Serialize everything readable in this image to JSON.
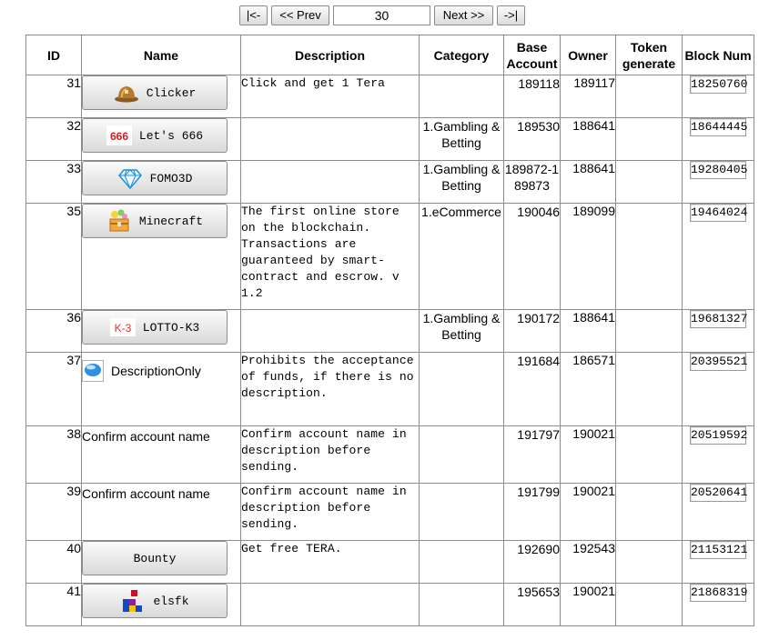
{
  "pager": {
    "first_label": "|<-",
    "prev_label": "<< Prev",
    "page_value": "30",
    "next_label": "Next >>",
    "last_label": "->|"
  },
  "table": {
    "headers": {
      "id": "ID",
      "name": "Name",
      "description": "Description",
      "category": "Category",
      "base_account_1": "Base",
      "base_account_2": "Account",
      "owner": "Owner",
      "token_1": "Token",
      "token_2": "generate",
      "block": "Block Num"
    },
    "rows": [
      {
        "id": "31",
        "name": "Clicker",
        "icon": "helmet-icon",
        "description": "Click and get 1 Tera",
        "category": "",
        "base": "189118",
        "owner": "189117",
        "token": "",
        "block": "18250760"
      },
      {
        "id": "32",
        "name": "Let's 666",
        "icon": "666-logo-icon",
        "description": "",
        "category": "1.Gambling & Betting",
        "base": "189530",
        "owner": "188641",
        "token": "",
        "block": "18644445"
      },
      {
        "id": "33",
        "name": "FOMO3D",
        "icon": "diamond-icon",
        "description": "",
        "category": "1.Gambling & Betting",
        "base": "189872-189873",
        "owner": "188641",
        "token": "",
        "block": "19280405"
      },
      {
        "id": "35",
        "name": "Minecraft",
        "icon": "treasure-chest-icon",
        "description": "The first online store on the blockchain. Transactions are guaranteed by smart-contract and escrow. v 1.2",
        "category": "1.eCommerce",
        "base": "190046",
        "owner": "189099",
        "token": "",
        "block": "19464024"
      },
      {
        "id": "36",
        "name": "LOTTO-K3",
        "icon": "k3-logo-icon",
        "description": "",
        "category": "1.Gambling & Betting",
        "base": "190172",
        "owner": "188641",
        "token": "",
        "block": "19681327"
      },
      {
        "id": "37",
        "name": "DescriptionOnly",
        "icon": "blue-sphere-icon",
        "description": "Prohibits the acceptance of funds, if there is no description.",
        "category": "",
        "base": "191684",
        "owner": "186571",
        "token": "",
        "block": "20395521"
      },
      {
        "id": "38",
        "name": "Confirm account name",
        "icon": "",
        "description": "Confirm account name in description before sending.",
        "category": "",
        "base": "191797",
        "owner": "190021",
        "token": "",
        "block": "20519592"
      },
      {
        "id": "39",
        "name": "Confirm account name",
        "icon": "",
        "description": "Confirm account name in description before sending.",
        "category": "",
        "base": "191799",
        "owner": "190021",
        "token": "",
        "block": "20520641"
      },
      {
        "id": "40",
        "name": "Bounty",
        "icon": "",
        "description": "Get free TERA.",
        "category": "",
        "base": "192690",
        "owner": "192543",
        "token": "",
        "block": "21153121"
      },
      {
        "id": "41",
        "name": "elsfk",
        "icon": "tetris-blocks-icon",
        "description": "",
        "category": "",
        "base": "195653",
        "owner": "190021",
        "token": "",
        "block": "21868319"
      }
    ]
  }
}
